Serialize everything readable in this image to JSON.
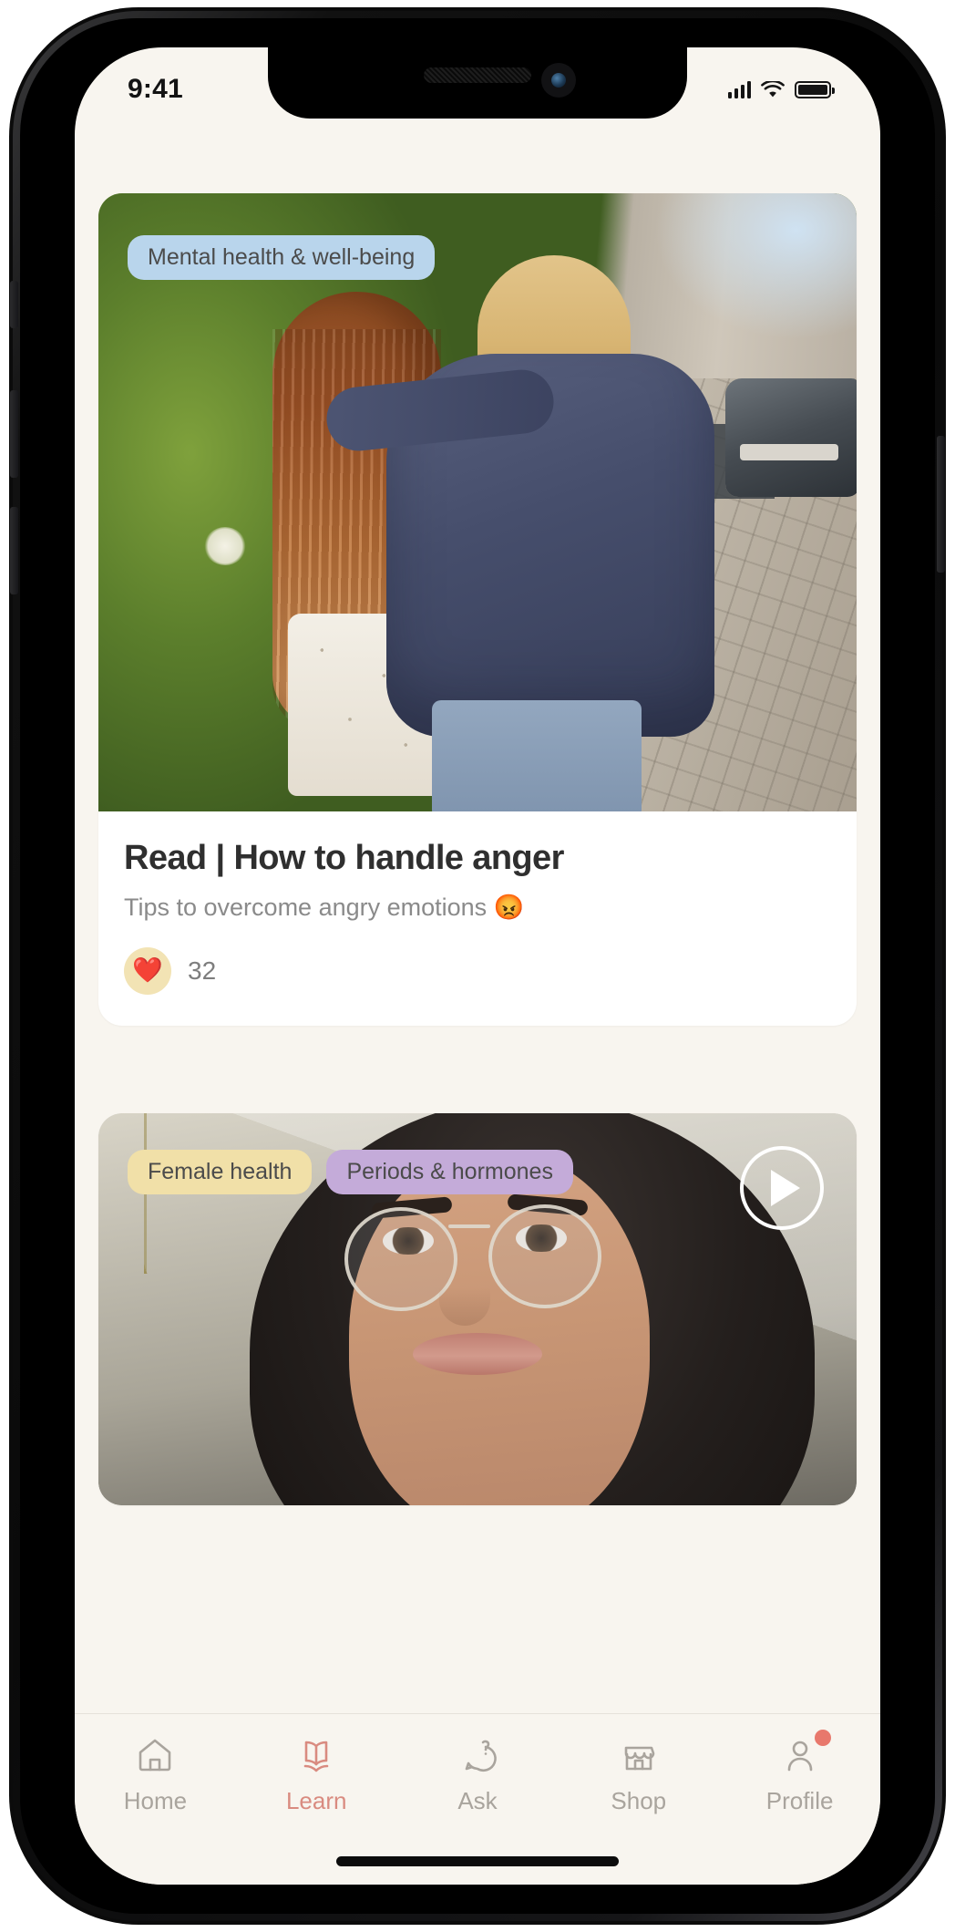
{
  "status_bar": {
    "time": "9:41",
    "icons": [
      "cellular-signal-icon",
      "wifi-icon",
      "battery-icon"
    ]
  },
  "theme": {
    "background": "#f8f5ef",
    "card_background": "#ffffff",
    "accent": "#d98b80",
    "badge_dot": "#e8786c",
    "tag_blue": "#b9d5ec",
    "tag_yellow": "#f1e0a8",
    "tag_purple": "#c4abd9",
    "like_bubble": "#f2e3b4",
    "text_primary": "#2f2f2f",
    "text_muted": "#8a8a8a",
    "tab_inactive": "#a9a49d"
  },
  "feed": {
    "cards": [
      {
        "tags": [
          {
            "label": "Mental health & well-being",
            "color": "blue"
          }
        ],
        "image_alt": "Two friends walking arm in arm down a sunny street",
        "title": "Read | How to handle anger",
        "subtitle": "Tips to overcome angry emotions 😡",
        "like_emoji": "❤️",
        "like_count": "32",
        "has_video": false
      },
      {
        "tags": [
          {
            "label": "Female health",
            "color": "yellow"
          },
          {
            "label": "Periods & hormones",
            "color": "purple"
          }
        ],
        "image_alt": "Smiling woman with wavy dark hair wearing round glasses",
        "has_video": true,
        "play_label": "Play video"
      }
    ]
  },
  "tabbar": {
    "active": "Learn",
    "items": [
      {
        "label": "Home",
        "icon": "house-icon",
        "active": false,
        "badge": false
      },
      {
        "label": "Learn",
        "icon": "open-book-icon",
        "active": true,
        "badge": false
      },
      {
        "label": "Ask",
        "icon": "question-bubble-icon",
        "active": false,
        "badge": false
      },
      {
        "label": "Shop",
        "icon": "storefront-icon",
        "active": false,
        "badge": false
      },
      {
        "label": "Profile",
        "icon": "person-icon",
        "active": false,
        "badge": true
      }
    ]
  }
}
